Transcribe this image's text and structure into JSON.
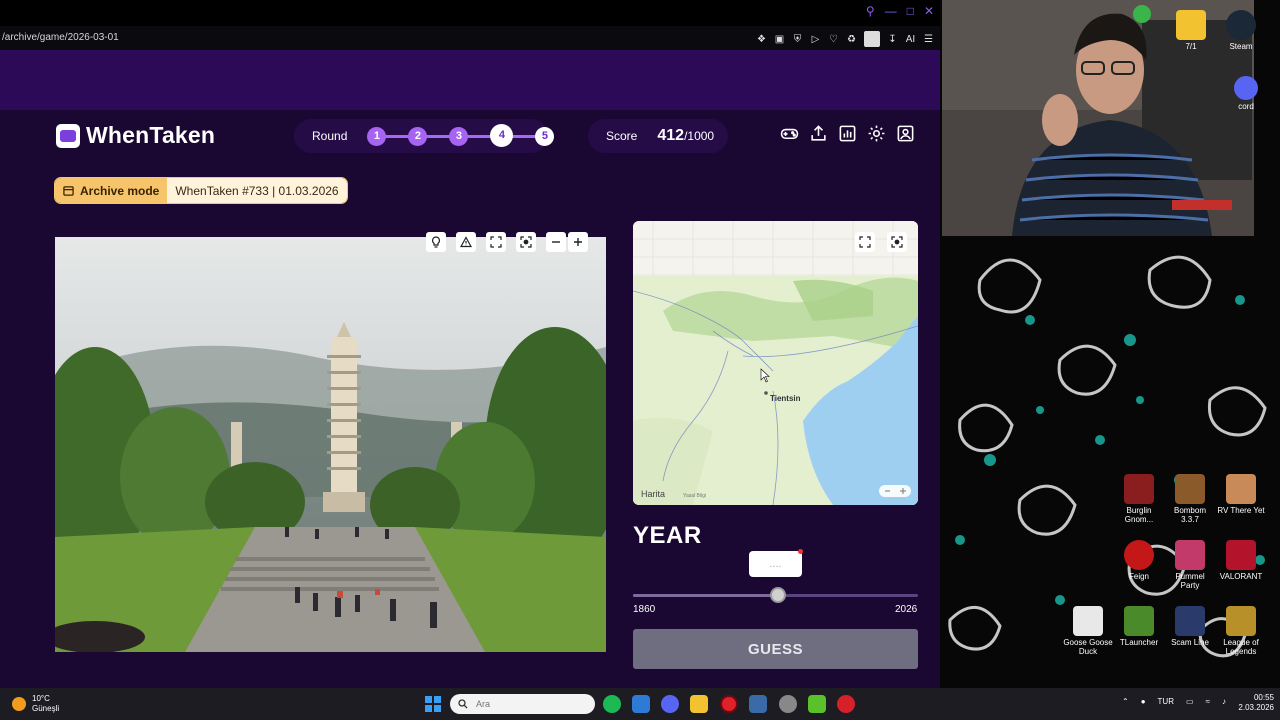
{
  "browser": {
    "url": "/archive/game/2026-03-01",
    "ai_label": "AI"
  },
  "header": {
    "logo_text": "WhenTaken",
    "round_label": "Round",
    "rounds": [
      "1",
      "2",
      "3",
      "4",
      "5"
    ],
    "current_round": 4,
    "score_label": "Score",
    "score_value": "412",
    "score_max": "/1000"
  },
  "archive": {
    "mode_label": "Archive mode",
    "info": "WhenTaken #733 | 01.03.2026"
  },
  "map": {
    "city_label": "Tientsin",
    "attribution": "Harita",
    "legal": "Yasal Bilgi"
  },
  "year": {
    "title": "YEAR",
    "tooltip": "....",
    "min": "1860",
    "max": "2026",
    "value_fraction": 0.51
  },
  "guess_label": "GUESS",
  "desktop": {
    "top_icons": [
      {
        "label": "7/1",
        "color": "#f2c230"
      },
      {
        "label": "Steam",
        "color": "#1b2838"
      },
      {
        "label": "cord",
        "color": "#5865f2"
      }
    ],
    "icons": [
      {
        "label": "Burglin Gnom...",
        "color": "#8a1d1d"
      },
      {
        "label": "Bombom 3.3.7",
        "color": "#8a5a2a"
      },
      {
        "label": "RV There Yet",
        "color": "#c98a5a"
      },
      {
        "label": "Feign",
        "color": "#c41818"
      },
      {
        "label": "Pummel Party",
        "color": "#c23a6a"
      },
      {
        "label": "VALORANT",
        "color": "#b3142b"
      },
      {
        "label": "Goose Goose Duck",
        "color": "#e8e8e8"
      },
      {
        "label": "TLauncher",
        "color": "#4a8a2a"
      },
      {
        "label": "Scam Line",
        "color": "#2a3a6a"
      },
      {
        "label": "League of Legends",
        "color": "#b8902a"
      }
    ]
  },
  "taskbar": {
    "temperature": "10°C",
    "weather": "Güneşli",
    "search_placeholder": "Ara",
    "language": "TUR",
    "time": "00:55",
    "date": "2.03.2026"
  }
}
